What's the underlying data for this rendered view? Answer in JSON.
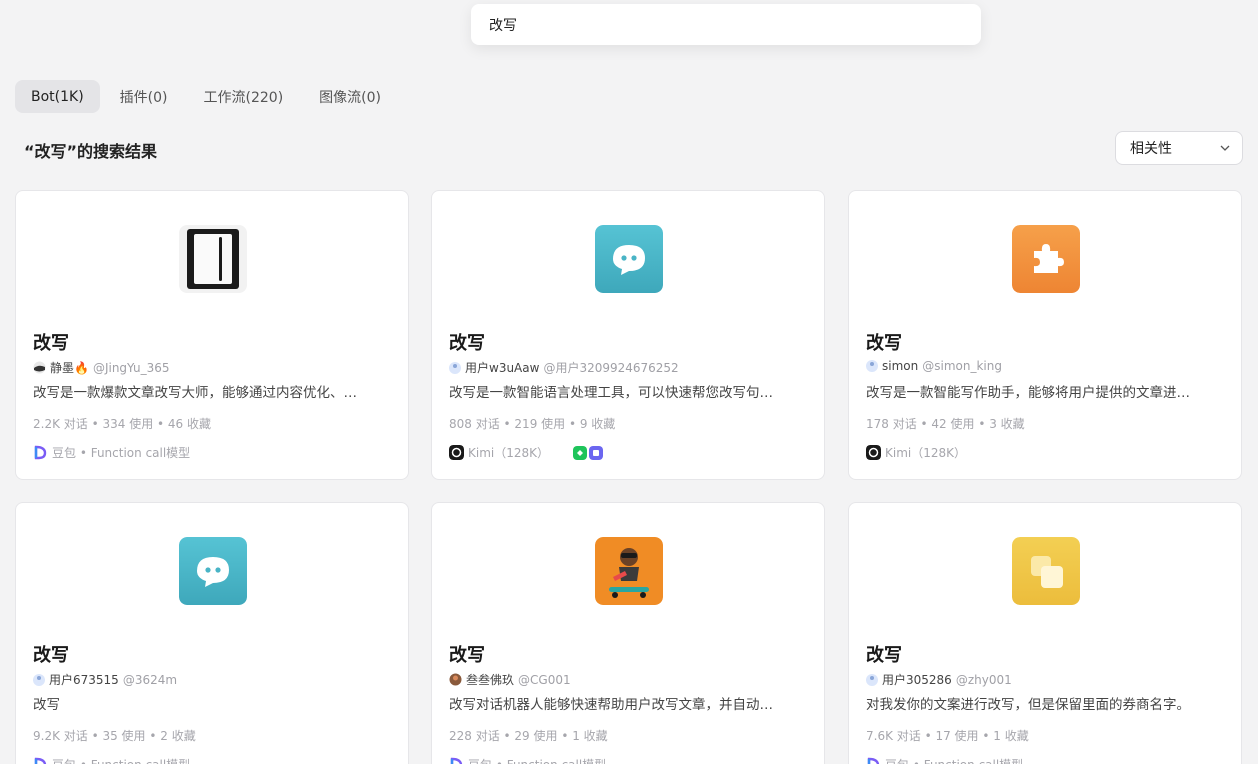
{
  "search": {
    "value": "改写"
  },
  "tabs": [
    {
      "label": "Bot(1K)",
      "active": true
    },
    {
      "label": "插件(0)"
    },
    {
      "label": "工作流(220)"
    },
    {
      "label": "图像流(0)"
    }
  ],
  "results_title": "“改写”的搜索结果",
  "sort": {
    "selected": "相关性"
  },
  "cards": [
    {
      "title": "改写",
      "author": "静墨🔥",
      "handle": "@JingYu_365",
      "desc": "改写是一款爆款文章改写大师，能够通过内容优化、…",
      "stats": "2.2K 对话 • 334 使用 • 46 收藏",
      "model": "豆包 • Function call模型",
      "icon": "notebook-icon"
    },
    {
      "title": "改写",
      "author": "用户w3uAaw",
      "handle": "@用户3209924676252",
      "desc": "改写是一款智能语言处理工具，可以快速帮您改写句…",
      "stats": "808 对话 • 219 使用 • 9 收藏",
      "model": "Kimi（128K）",
      "icon": "chat-bubble-icon"
    },
    {
      "title": "改写",
      "author": "simon",
      "handle": "@simon_king",
      "desc": "改写是一款智能写作助手，能够将用户提供的文章进…",
      "stats": "178 对话 • 42 使用 • 3 收藏",
      "model": "Kimi（128K）",
      "icon": "puzzle-icon"
    },
    {
      "title": "改写",
      "author": "用户673515",
      "handle": "@3624m",
      "desc": "改写",
      "stats": "9.2K 对话 • 35 使用 • 2 收藏",
      "model": "豆包 • Function call模型",
      "icon": "chat-bubble-icon"
    },
    {
      "title": "改写",
      "author": "叁叁佛玖",
      "handle": "@CG001",
      "desc": "改写对话机器人能够快速帮助用户改写文章，并自动…",
      "stats": "228 对话 • 29 使用 • 1 收藏",
      "model": "豆包 • Function call模型",
      "icon": "monkey-skateboard-icon"
    },
    {
      "title": "改写",
      "author": "用户305286",
      "handle": "@zhy001",
      "desc": "对我发你的文案进行改写，但是保留里面的券商名字。",
      "stats": "7.6K 对话 • 17 使用 • 1 收藏",
      "model": "豆包 • Function call模型",
      "icon": "layers-icon"
    }
  ]
}
